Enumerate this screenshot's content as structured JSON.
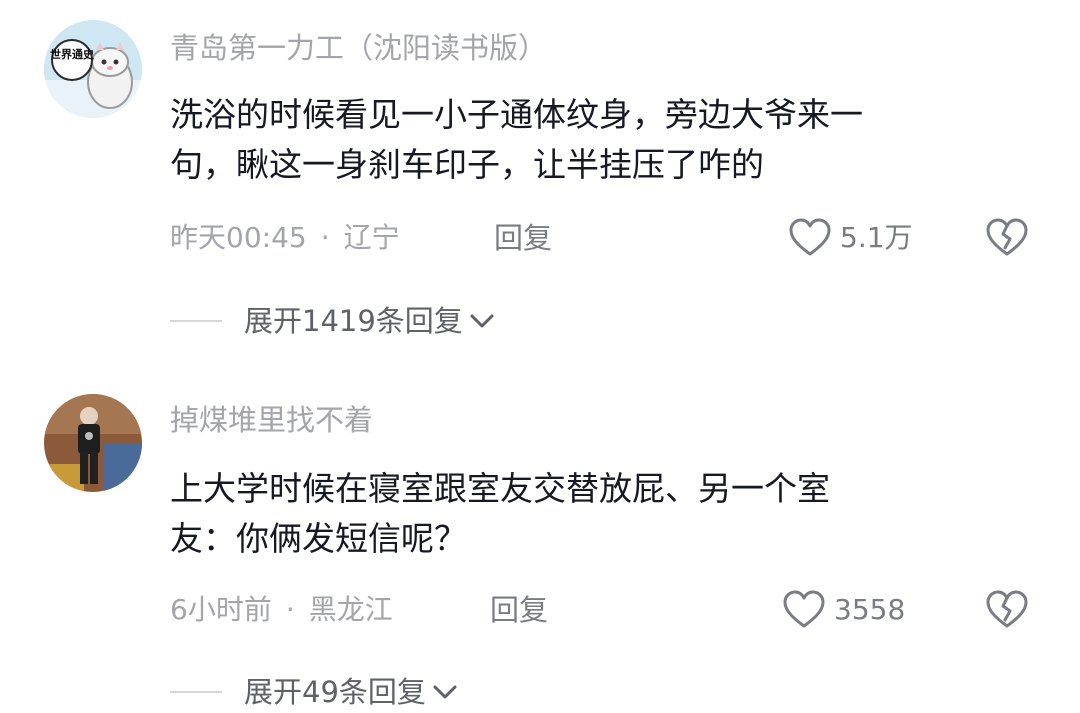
{
  "comments": [
    {
      "username": "青岛第一力工（沈阳读书版）",
      "avatar_text": "世界通史",
      "lines": [
        "洗浴的时候看见一小子通体纹身，旁边大爷来一",
        "句，瞅这一身刹车印子，让半挂压了咋的"
      ],
      "time": "昨天00:45",
      "location": "辽宁",
      "separator": "·",
      "reply_label": "回复",
      "likes": "5.1万",
      "expand_label": "展开1419条回复"
    },
    {
      "username": "掉煤堆里找不着",
      "lines": [
        "上大学时候在寝室跟室友交替放屁、另一个室",
        "友：你俩发短信呢？"
      ],
      "time": "6小时前",
      "location": "黑龙江",
      "separator": "·",
      "reply_label": "回复",
      "likes": "3558",
      "expand_label": "展开49条回复"
    }
  ],
  "colors": {
    "text_primary": "#161823",
    "text_secondary": "#a3a5ab",
    "action": "#7a7c84"
  },
  "icons": [
    "heart-outline-icon",
    "broken-heart-icon",
    "chevron-down-icon"
  ]
}
